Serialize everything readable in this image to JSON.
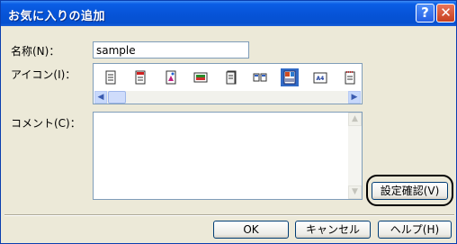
{
  "window": {
    "title": "お気に入りの追加",
    "help_glyph": "?",
    "close_glyph": "✕"
  },
  "form": {
    "name_label": "名称(N)：",
    "name_value": "sample",
    "icon_label": "アイコン(I)：",
    "comment_label": "コメント(C)：",
    "comment_value": ""
  },
  "icons": [
    {
      "name": "document-icon",
      "selected": false
    },
    {
      "name": "red-document-icon",
      "selected": false
    },
    {
      "name": "image-document-icon",
      "selected": false
    },
    {
      "name": "landscape-picture-icon",
      "selected": false
    },
    {
      "name": "booklet-icon",
      "selected": false
    },
    {
      "name": "n-up-pages-icon",
      "selected": false
    },
    {
      "name": "multi-page-layout-icon",
      "selected": true
    },
    {
      "name": "a4-page-icon",
      "selected": false
    },
    {
      "name": "notepad-icon",
      "selected": false
    }
  ],
  "scrollbar": {
    "left_arrow": "◀",
    "right_arrow": "▶",
    "up_arrow": "▲",
    "down_arrow": "▼"
  },
  "buttons": {
    "settings_confirm": "設定確認(V)",
    "ok": "OK",
    "cancel": "キャンセル",
    "help": "ヘルプ(H)"
  },
  "colors": {
    "title_bar": "#0754d8",
    "highlight": "#316ac5",
    "dialog_bg": "#ece9d8"
  }
}
